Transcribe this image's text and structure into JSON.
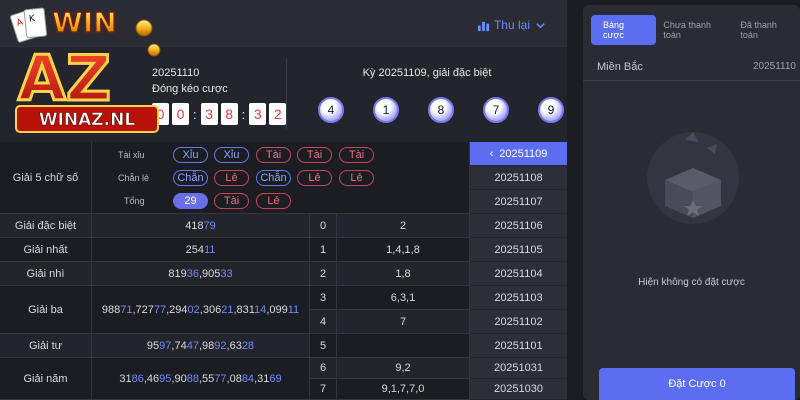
{
  "header": {
    "history_label": "Thu lại"
  },
  "current": {
    "period": "20251110",
    "subtitle": "Đóng kéo cược",
    "countdown": [
      "0",
      "0",
      "3",
      "8",
      "3",
      "2"
    ]
  },
  "last_result": {
    "title": "Kỳ 20251109, giải đặc biệt",
    "balls": [
      "4",
      "1",
      "8",
      "7",
      "9"
    ]
  },
  "logo": {
    "text_top": "WIN",
    "text_mid": "AZ",
    "text_bottom": "WINAZ.NL"
  },
  "five_digit": {
    "label": "Giải 5 chữ số",
    "rows": [
      {
        "label": "Tài xỉu",
        "pills": [
          {
            "text": "Xỉu",
            "style": "blue"
          },
          {
            "text": "Xỉu",
            "style": "blue"
          },
          {
            "text": "Tài",
            "style": "red"
          },
          {
            "text": "Tài",
            "style": "red"
          },
          {
            "text": "Tài",
            "style": "red"
          }
        ]
      },
      {
        "label": "Chẵn lẻ",
        "pills": [
          {
            "text": "Chẵn",
            "style": "blue"
          },
          {
            "text": "Lẻ",
            "style": "red"
          },
          {
            "text": "Chẵn",
            "style": "blue"
          },
          {
            "text": "Lẻ",
            "style": "red"
          },
          {
            "text": "Lẻ",
            "style": "red"
          }
        ]
      },
      {
        "label": "Tổng",
        "pills": [
          {
            "text": "29",
            "style": "fill"
          },
          {
            "text": "Tài",
            "style": "red"
          },
          {
            "text": "Lẻ",
            "style": "red"
          }
        ]
      }
    ]
  },
  "prizes": [
    {
      "name": "Giải đặc biệt",
      "parts": [
        [
          "418",
          false
        ],
        [
          "79",
          true
        ]
      ]
    },
    {
      "name": "Giải nhất",
      "parts": [
        [
          "254",
          false
        ],
        [
          "11",
          true
        ]
      ]
    },
    {
      "name": "Giải nhì",
      "parts": [
        [
          "819",
          false
        ],
        [
          "36",
          true
        ],
        [
          ",905",
          false
        ],
        [
          "33",
          true
        ]
      ]
    },
    {
      "name": "Giải ba",
      "parts": [
        [
          "988",
          false
        ],
        [
          "71",
          true
        ],
        [
          ",727",
          false
        ],
        [
          "77",
          true
        ],
        [
          ",294",
          false
        ],
        [
          "02",
          true
        ],
        [
          ",306",
          false
        ],
        [
          "21",
          true
        ],
        [
          ",831",
          false
        ],
        [
          "14",
          true
        ],
        [
          ",099",
          false
        ],
        [
          "11",
          true
        ]
      ]
    },
    {
      "name": "Giải tư",
      "parts": [
        [
          "95",
          false
        ],
        [
          "97",
          true
        ],
        [
          ",74",
          false
        ],
        [
          "47",
          true
        ],
        [
          ",98",
          false
        ],
        [
          "92",
          true
        ],
        [
          ",63",
          false
        ],
        [
          "28",
          true
        ]
      ]
    },
    {
      "name": "Giải năm",
      "parts": [
        [
          "31",
          false
        ],
        [
          "86",
          true
        ],
        [
          ",46",
          false
        ],
        [
          "95",
          true
        ],
        [
          ",90",
          false
        ],
        [
          "88",
          true
        ],
        [
          ",55",
          false
        ],
        [
          "77",
          true
        ],
        [
          ",08",
          false
        ],
        [
          "84",
          true
        ],
        [
          ",31",
          false
        ],
        [
          "69",
          true
        ]
      ]
    }
  ],
  "tails": [
    {
      "head": "0",
      "value": "2"
    },
    {
      "head": "1",
      "value": "1,4,1,8"
    },
    {
      "head": "2",
      "value": "1,8"
    },
    {
      "head": "3",
      "value": "6,3,1"
    },
    {
      "head": "4",
      "value": "7"
    },
    {
      "head": "5",
      "value": ""
    },
    {
      "head": "6",
      "value": "9,2"
    },
    {
      "head": "7",
      "value": "9,1,7,7,0"
    }
  ],
  "periods": [
    "20251109",
    "20251108",
    "20251107",
    "20251106",
    "20251105",
    "20251104",
    "20251103",
    "20251102",
    "20251101",
    "20251031",
    "20251030"
  ],
  "right_panel": {
    "tabs": [
      "Bảng cược",
      "Chưa thanh toán",
      "Đã thanh toán"
    ],
    "region": "Miền Bắc",
    "region_period": "20251110",
    "empty_text": "Hiện không có đặt cược",
    "bet_button": "Đặt Cược 0"
  },
  "colors": {
    "accent": "#5b6ef2",
    "highlight_digits": "#6e8cff",
    "red": "#ef6f80",
    "countdown_digit": "#e23b4b"
  }
}
